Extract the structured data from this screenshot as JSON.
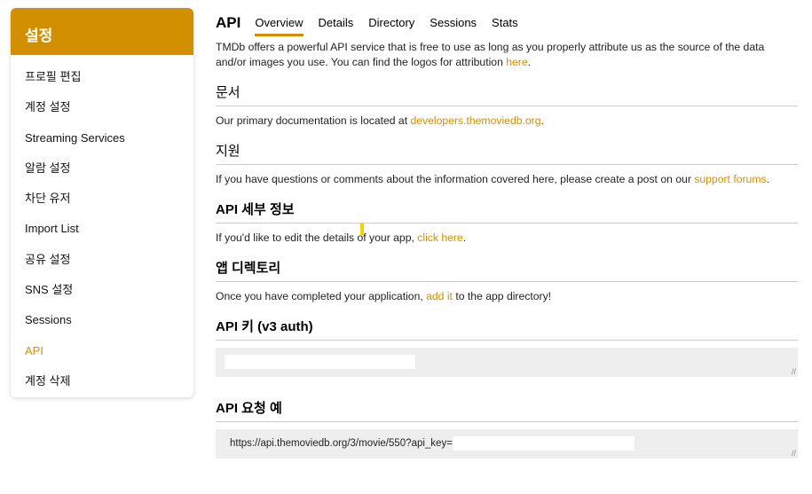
{
  "sidebar": {
    "title": "설정",
    "items": [
      "프로필 편집",
      "계정 설정",
      "Streaming Services",
      "알람 설정",
      "차단 유저",
      "Import List",
      "공유 설정",
      "SNS 설정",
      "Sessions",
      "API",
      "계정 삭제"
    ],
    "active": "API"
  },
  "header": {
    "title": "API",
    "tabs": [
      "Overview",
      "Details",
      "Directory",
      "Sessions",
      "Stats"
    ]
  },
  "intro": {
    "text": "TMDb offers a powerful API service that is free to use as long as you properly attribute us as the source of the data and/or images you use. You can find the logos for attribution ",
    "link": "here",
    "end": "."
  },
  "sections": [
    {
      "title": "문서",
      "pre": "Our primary documentation is located at ",
      "link": "developers.themoviedb.org",
      "post": "."
    },
    {
      "title": "지원",
      "pre": "If you have questions or comments about the information covered here, please create a post on our ",
      "link": "support forums",
      "post": "."
    },
    {
      "title": "API 세부 정보",
      "pre": "If you'd like to edit the details of your app, ",
      "link": "click here",
      "post": "."
    },
    {
      "title": "앱 디렉토리",
      "pre": "Once you have completed your application, ",
      "link": "add it",
      "post": " to the app directory!"
    }
  ],
  "api_key": {
    "title": "API 키 (v3 auth)",
    "value": ""
  },
  "example": {
    "title": "API 요청 예",
    "value": "https://api.themoviedb.org/3/movie/550?api_key="
  },
  "accent": "#d29001"
}
